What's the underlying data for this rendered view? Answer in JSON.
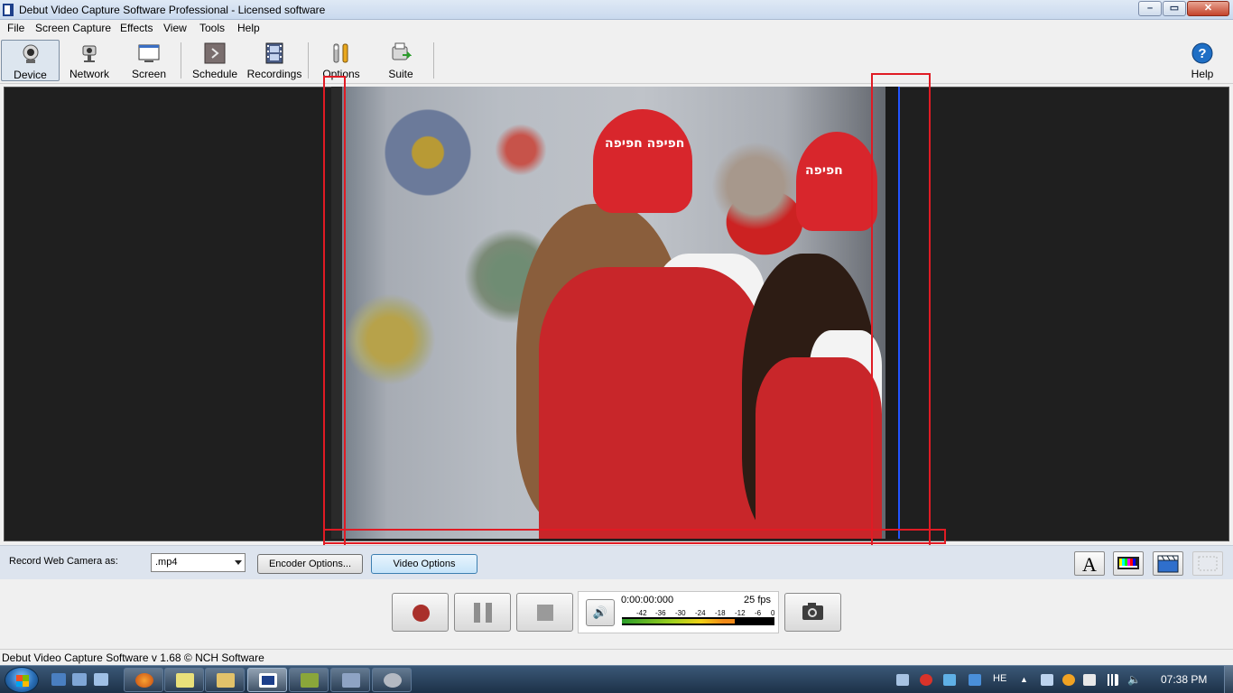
{
  "window": {
    "title": "Debut Video Capture Software Professional - Licensed software"
  },
  "menu": [
    "File",
    "Screen Capture",
    "Effects",
    "View",
    "Tools",
    "Help"
  ],
  "toolbar": {
    "device": "Device",
    "network": "Network",
    "screen": "Screen",
    "schedule": "Schedule",
    "recordings": "Recordings",
    "options": "Options",
    "suite": "Suite",
    "help": "Help"
  },
  "video": {
    "cap_text_left": "חפיפה חפיפה",
    "cap_text_right": "חפיפה"
  },
  "options_bar": {
    "record_label": "Record Web Camera as:",
    "format_value": ".mp4",
    "encoder_button": "Encoder Options...",
    "video_button": "Video Options"
  },
  "transport": {
    "timecode": "0:00:00:000",
    "fps": "25 fps",
    "scale": [
      "-42",
      "-36",
      "-30",
      "-24",
      "-18",
      "-12",
      "-6",
      "0"
    ],
    "level_fraction": 0.74
  },
  "status": {
    "text": "Debut Video Capture Software v 1.68 © NCH Software"
  },
  "taskbar": {
    "language": "HE",
    "clock": "07:38 PM"
  },
  "colors": {
    "accent": "#3c7fb1",
    "annotation": "#e01b24",
    "record": "#a9302b"
  }
}
